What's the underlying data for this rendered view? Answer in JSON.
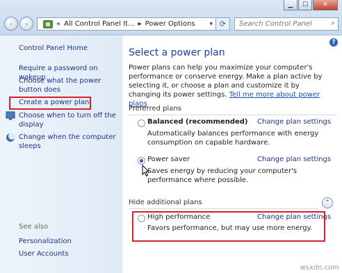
{
  "window": {
    "minimize_glyph": "▁",
    "maximize_glyph": "☐",
    "close_glyph": "✕"
  },
  "toolbar": {
    "back_glyph": "‹",
    "forward_glyph": "›",
    "breadcrumb_sep": "«",
    "crumb_1": "All Control Panel It...",
    "crumb_arrow": "▸",
    "crumb_2": "Power Options",
    "dropdown_glyph": "▾",
    "refresh_glyph": "⟳",
    "search_placeholder": "Search Control Panel",
    "search_glyph": "⌕"
  },
  "sidebar": {
    "home": "Control Panel Home",
    "items": [
      {
        "label": "Require a password on wakeup"
      },
      {
        "label": "Choose what the power button does"
      },
      {
        "label": "Create a power plan"
      },
      {
        "label": "Choose when to turn off the display"
      },
      {
        "label": "Change when the computer sleeps"
      }
    ],
    "see_also": "See also",
    "see_also_items": [
      {
        "label": "Personalization"
      },
      {
        "label": "User Accounts"
      }
    ]
  },
  "main": {
    "help_glyph": "?",
    "title": "Select a power plan",
    "intro": "Power plans can help you maximize your computer's performance or conserve energy. Make a plan active by selecting it, or choose a plan and customize it by changing its power settings.",
    "intro_link": "Tell me more about power plans",
    "preferred_heading": "Preferred plans",
    "hidden_heading": "Hide additional plans",
    "collapse_glyph": "⌃",
    "change_label": "Change plan settings",
    "plans": [
      {
        "name": "Balanced (recommended)",
        "description": "Automatically balances performance with energy consumption on capable hardware.",
        "selected": false
      },
      {
        "name": "Power saver",
        "description": "Saves energy by reducing your computer's performance where possible.",
        "selected": true
      },
      {
        "name": "High performance",
        "description": "Favors performance, but may use more energy.",
        "selected": false
      }
    ]
  },
  "watermark": "wsxdn.com",
  "colors": {
    "highlight": "#d4202c",
    "link": "#1e3287",
    "title": "#1c3f95"
  }
}
